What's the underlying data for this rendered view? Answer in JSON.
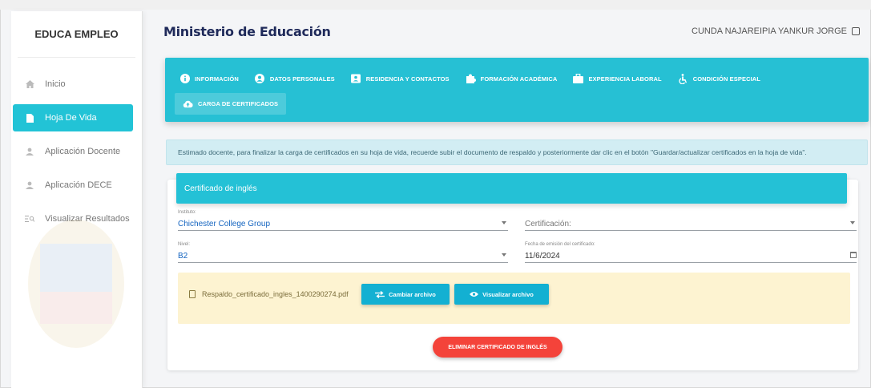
{
  "sidebar": {
    "brand": "EDUCA EMPLEO",
    "items": [
      {
        "label": "Inicio",
        "icon": "home-icon",
        "active": false
      },
      {
        "label": "Hoja De Vida",
        "icon": "document-icon",
        "active": true
      },
      {
        "label": "Aplicación Docente",
        "icon": "user-icon",
        "active": false
      },
      {
        "label": "Aplicación DECE",
        "icon": "user-icon",
        "active": false
      },
      {
        "label": "Visualizar Resultados",
        "icon": "list-search-icon",
        "active": false
      }
    ]
  },
  "header": {
    "title": "Ministerio de Educación",
    "user": "CUNDA NAJAREIPIA YANKUR JORGE"
  },
  "tabs": [
    {
      "label": "INFORMACIÓN",
      "icon": "info-icon"
    },
    {
      "label": "DATOS PERSONALES",
      "icon": "account-circle-icon"
    },
    {
      "label": "RESIDENCIA Y CONTACTOS",
      "icon": "contact-card-icon"
    },
    {
      "label": "FORMACIÓN ACADÉMICA",
      "icon": "puzzle-icon"
    },
    {
      "label": "EXPERIENCIA LABORAL",
      "icon": "briefcase-icon"
    },
    {
      "label": "CONDICIÓN ESPECIAL",
      "icon": "accessibility-icon"
    },
    {
      "label": "CARGA DE CERTIFICADOS",
      "icon": "cloud-upload-icon",
      "selected": true
    }
  ],
  "notice": "Estimado docente, para finalizar la carga de certificados en su hoja de vida, recuerde subir el documento de respaldo y posteriormente dar clic en el botón \"Guardar/actualizar certificados en la hoja de vida\".",
  "card": {
    "title": "Certificado de inglés",
    "instituto": {
      "label": "Instituto:",
      "value": "Chichester College Group"
    },
    "certificacion": {
      "placeholder": "Certificación:"
    },
    "nivel": {
      "label": "Nivel:",
      "value": "B2"
    },
    "fecha": {
      "label": "Fecha de emisión del certificado:",
      "value": "11/6/2024"
    },
    "file_name": "Respaldo_certificado_ingles_1400290274.pdf",
    "change_button": "Cambiar archivo",
    "view_button": "Visualizar archivo",
    "delete_button": "ELIMINAR CERTIFICADO DE INGLÉS"
  },
  "colors": {
    "accent": "#26c0d4",
    "danger": "#f4433a",
    "upload_bg": "#fdf3d1",
    "title": "#1f2a5a"
  }
}
